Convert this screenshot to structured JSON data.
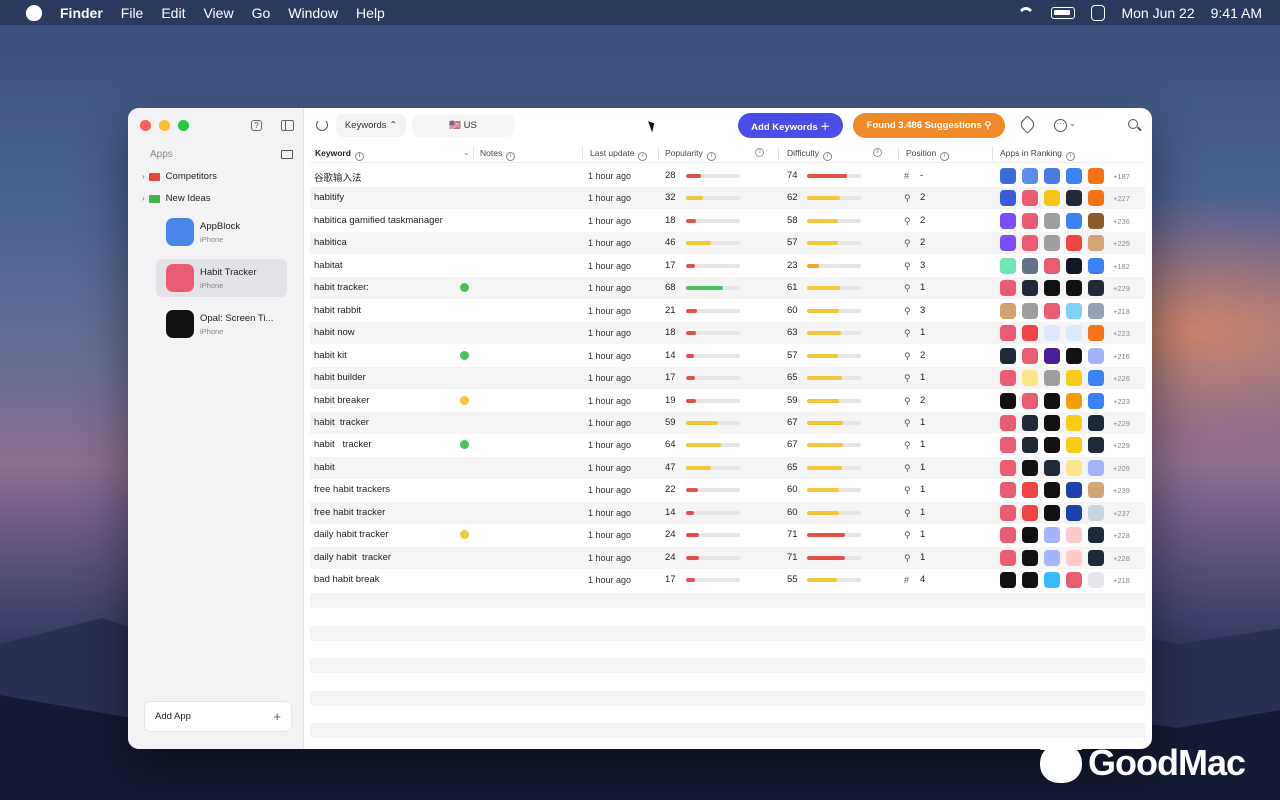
{
  "menubar": {
    "app": "Finder",
    "items": [
      "File",
      "Edit",
      "View",
      "Go",
      "Window",
      "Help"
    ],
    "date": "Mon Jun 22",
    "time": "9:41 AM"
  },
  "sidebar": {
    "title": "Apps",
    "folders": [
      {
        "label": "Competitors",
        "color": "#e5473d"
      },
      {
        "label": "New Ideas",
        "color": "#3fb34f"
      }
    ],
    "apps": [
      {
        "name": "AppBlock",
        "device": "iPhone",
        "color": "#4a86e8",
        "selected": false
      },
      {
        "name": "Habit Tracker",
        "device": "iPhone",
        "color": "#e95c74",
        "selected": true
      },
      {
        "name": "Opal: Screen Ti...",
        "device": "iPhone",
        "color": "#111111",
        "selected": false
      }
    ],
    "add_label": "Add App"
  },
  "toolbar": {
    "source_label": "Keywords ⌃",
    "country_label": "🇺🇸 US",
    "add_keywords_label": "Add Keywords  ＋",
    "suggestions_label": "Found 3.486 Suggestions  ⚲"
  },
  "columns": {
    "keyword": "Keyword",
    "notes": "Notes",
    "last_update": "Last update",
    "popularity": "Popularity",
    "difficulty": "Difficulty",
    "position": "Position",
    "apps_in_ranking": "Apps in Ranking"
  },
  "colors": {
    "accent_blue": "#4b4de6",
    "accent_orange": "#f08a28",
    "bar_yellow": "#f2c73c",
    "bar_red": "#e2504a",
    "bar_green": "#4cc060",
    "bar_orange": "#f0a830"
  },
  "rows": [
    {
      "keyword": "谷歌输入法",
      "note": null,
      "updated": "1 hour ago",
      "pop": 28,
      "diff": 74,
      "pos_icon": "#",
      "pos": "-",
      "icons": [
        "#3a6fd8",
        "#5b8dea",
        "#4a7be0",
        "#3b82f6",
        "#f97316"
      ],
      "more": "+187"
    },
    {
      "keyword": "habitify",
      "note": null,
      "updated": "1 hour ago",
      "pop": 32,
      "diff": 62,
      "pos_icon": "⚲",
      "pos": "2",
      "icons": [
        "#3b5bdb",
        "#e95c74",
        "#f5c518",
        "#1f2937",
        "#f97316"
      ],
      "more": "+227"
    },
    {
      "keyword": "habitica gamified taskmanager",
      "note": null,
      "updated": "1 hour ago",
      "pop": 18,
      "diff": 58,
      "pos_icon": "⚲",
      "pos": "2",
      "icons": [
        "#7c4dff",
        "#e95c74",
        "#9e9e9e",
        "#3b82f6",
        "#8d5a2b"
      ],
      "more": "+236"
    },
    {
      "keyword": "habitica",
      "note": null,
      "updated": "1 hour ago",
      "pop": 46,
      "diff": 57,
      "pos_icon": "⚲",
      "pos": "2",
      "icons": [
        "#7c4dff",
        "#e95c74",
        "#9e9e9e",
        "#ef4444",
        "#d4a373"
      ],
      "more": "+225"
    },
    {
      "keyword": "habitat",
      "note": null,
      "updated": "1 hour ago",
      "pop": 17,
      "diff": 23,
      "pos_icon": "⚲",
      "pos": "3",
      "icons": [
        "#6ee7b7",
        "#64748b",
        "#e95c74",
        "#111827",
        "#3b82f6"
      ],
      "more": "+182"
    },
    {
      "keyword": "habit tracker:",
      "note": "#4cc060",
      "updated": "1 hour ago",
      "pop": 68,
      "diff": 61,
      "pos_icon": "⚲",
      "pos": "1",
      "icons": [
        "#e95c74",
        "#1f2937",
        "#111111",
        "#111111",
        "#1f2937"
      ],
      "more": "+229"
    },
    {
      "keyword": "habit rabbit",
      "note": null,
      "updated": "1 hour ago",
      "pop": 21,
      "diff": 60,
      "pos_icon": "⚲",
      "pos": "3",
      "icons": [
        "#d4a373",
        "#9e9e9e",
        "#e95c74",
        "#7dd3fc",
        "#94a3b8"
      ],
      "more": "+218"
    },
    {
      "keyword": "habit now",
      "note": null,
      "updated": "1 hour ago",
      "pop": 18,
      "diff": 63,
      "pos_icon": "⚲",
      "pos": "1",
      "icons": [
        "#e95c74",
        "#ef4444",
        "#e0e7ff",
        "#dbeafe",
        "#f97316"
      ],
      "more": "+223"
    },
    {
      "keyword": "habit kit",
      "note": "#4cc060",
      "updated": "1 hour ago",
      "pop": 14,
      "diff": 57,
      "pos_icon": "⚲",
      "pos": "2",
      "icons": [
        "#1f2937",
        "#e95c74",
        "#4c1d95",
        "#111111",
        "#a5b4fc"
      ],
      "more": "+216"
    },
    {
      "keyword": "habit builder",
      "note": null,
      "updated": "1 hour ago",
      "pop": 17,
      "diff": 65,
      "pos_icon": "⚲",
      "pos": "1",
      "icons": [
        "#e95c74",
        "#fde68a",
        "#9e9e9e",
        "#facc15",
        "#3b82f6"
      ],
      "more": "+226"
    },
    {
      "keyword": "habit breaker",
      "note": "#f2c73c",
      "updated": "1 hour ago",
      "pop": 19,
      "diff": 59,
      "pos_icon": "⚲",
      "pos": "2",
      "icons": [
        "#111111",
        "#e95c74",
        "#111111",
        "#f59e0b",
        "#3b82f6"
      ],
      "more": "+223"
    },
    {
      "keyword": "habit  tracker",
      "note": null,
      "updated": "1 hour ago",
      "pop": 59,
      "diff": 67,
      "pos_icon": "⚲",
      "pos": "1",
      "icons": [
        "#e95c74",
        "#1f2937",
        "#111111",
        "#facc15",
        "#1f2937"
      ],
      "more": "+229"
    },
    {
      "keyword": "habit   tracker",
      "note": "#4cc060",
      "updated": "1 hour ago",
      "pop": 64,
      "diff": 67,
      "pos_icon": "⚲",
      "pos": "1",
      "icons": [
        "#e95c74",
        "#1f2937",
        "#111111",
        "#facc15",
        "#1f2937"
      ],
      "more": "+229"
    },
    {
      "keyword": "habit",
      "note": null,
      "updated": "1 hour ago",
      "pop": 47,
      "diff": 65,
      "pos_icon": "⚲",
      "pos": "1",
      "icons": [
        "#e95c74",
        "#111111",
        "#1f2937",
        "#fde68a",
        "#a5b4fc"
      ],
      "more": "+209"
    },
    {
      "keyword": "free habit trackers",
      "note": null,
      "updated": "1 hour ago",
      "pop": 22,
      "diff": 60,
      "pos_icon": "⚲",
      "pos": "1",
      "icons": [
        "#e95c74",
        "#ef4444",
        "#111111",
        "#1e40af",
        "#d4a373"
      ],
      "more": "+239"
    },
    {
      "keyword": "free habit tracker",
      "note": null,
      "updated": "1 hour ago",
      "pop": 14,
      "diff": 60,
      "pos_icon": "⚲",
      "pos": "1",
      "icons": [
        "#e95c74",
        "#ef4444",
        "#111111",
        "#1e40af",
        "#cbd5e1"
      ],
      "more": "+237"
    },
    {
      "keyword": "daily habit tracker",
      "note": "#f2c73c",
      "updated": "1 hour ago",
      "pop": 24,
      "diff": 71,
      "pos_icon": "⚲",
      "pos": "1",
      "icons": [
        "#e95c74",
        "#111111",
        "#a5b4fc",
        "#fecaca",
        "#1f2937"
      ],
      "more": "+228"
    },
    {
      "keyword": "daily habit  tracker",
      "note": null,
      "updated": "1 hour ago",
      "pop": 24,
      "diff": 71,
      "pos_icon": "⚲",
      "pos": "1",
      "icons": [
        "#e95c74",
        "#111111",
        "#a5b4fc",
        "#fecaca",
        "#1f2937"
      ],
      "more": "+228"
    },
    {
      "keyword": "bad habit break",
      "note": null,
      "updated": "1 hour ago",
      "pop": 17,
      "diff": 55,
      "pos_icon": "#",
      "pos": "4",
      "icons": [
        "#111111",
        "#111111",
        "#38bdf8",
        "#e95c74",
        "#e5e7eb"
      ],
      "more": "+218"
    }
  ],
  "logo": {
    "text": "GoodMac"
  }
}
